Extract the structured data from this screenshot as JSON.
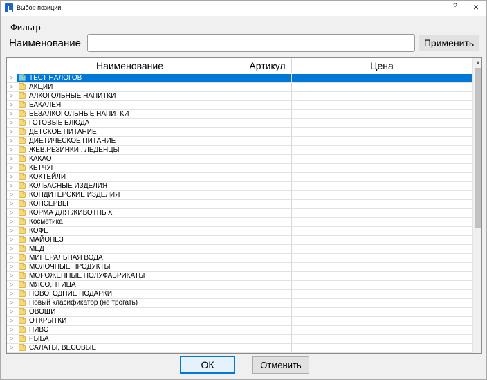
{
  "window": {
    "title": "Выбор позиции",
    "help_glyph": "?",
    "close_glyph": "×"
  },
  "filter": {
    "group_label": "Фильтр",
    "name_label": "Наименование",
    "name_value": "",
    "apply_label": "Применить"
  },
  "grid": {
    "columns": [
      "Наименование",
      "Артикул",
      "Цена"
    ],
    "rows": [
      {
        "label": "ТЕСТ НАЛОГОВ",
        "selected": true
      },
      {
        "label": "АКЦИИ"
      },
      {
        "label": "АЛКОГОЛЬНЫЕ НАПИТКИ"
      },
      {
        "label": "БАКАЛЕЯ"
      },
      {
        "label": "БЕЗАЛКОГОЛЬНЫЕ НАПИТКИ"
      },
      {
        "label": "ГОТОВЫЕ БЛЮДА"
      },
      {
        "label": "ДЕТСКОЕ ПИТАНИЕ"
      },
      {
        "label": "ДИЕТИЧЕСКОЕ ПИТАНИЕ"
      },
      {
        "label": "ЖЕВ.РЕЗИНКИ , ЛЕДЕНЦЫ"
      },
      {
        "label": "КАКАО"
      },
      {
        "label": "КЕТЧУП"
      },
      {
        "label": "КОКТЕЙЛИ"
      },
      {
        "label": "КОЛБАСНЫЕ ИЗДЕЛИЯ"
      },
      {
        "label": "КОНДИТЕРСКИЕ ИЗДЕЛИЯ"
      },
      {
        "label": "КОНСЕРВЫ"
      },
      {
        "label": "КОРМА ДЛЯ ЖИВОТНЫХ"
      },
      {
        "label": "Косметика"
      },
      {
        "label": "КОФЕ"
      },
      {
        "label": "МАЙОНЕЗ"
      },
      {
        "label": "МЕД"
      },
      {
        "label": "МИНЕРАЛЬНАЯ ВОДА"
      },
      {
        "label": "МОЛОЧНЫЕ ПРОДУКТЫ"
      },
      {
        "label": "МОРОЖЕННЫЕ ПОЛУФАБРИКАТЫ"
      },
      {
        "label": "МЯСО,ПТИЦА"
      },
      {
        "label": "НОВОГОДНИЕ ПОДАРКИ"
      },
      {
        "label": "Новый класификатор (не трогать)"
      },
      {
        "label": "ОВОЩИ"
      },
      {
        "label": "ОТКРЫТКИ"
      },
      {
        "label": "ПИВО"
      },
      {
        "label": "РЫБА"
      },
      {
        "label": "САЛАТЫ, ВЕСОВЫЕ"
      }
    ]
  },
  "buttons": {
    "ok_label": "ОК",
    "cancel_label": "Отменить"
  },
  "colors": {
    "selection": "#0078d7",
    "folder": "#f6d77a"
  }
}
